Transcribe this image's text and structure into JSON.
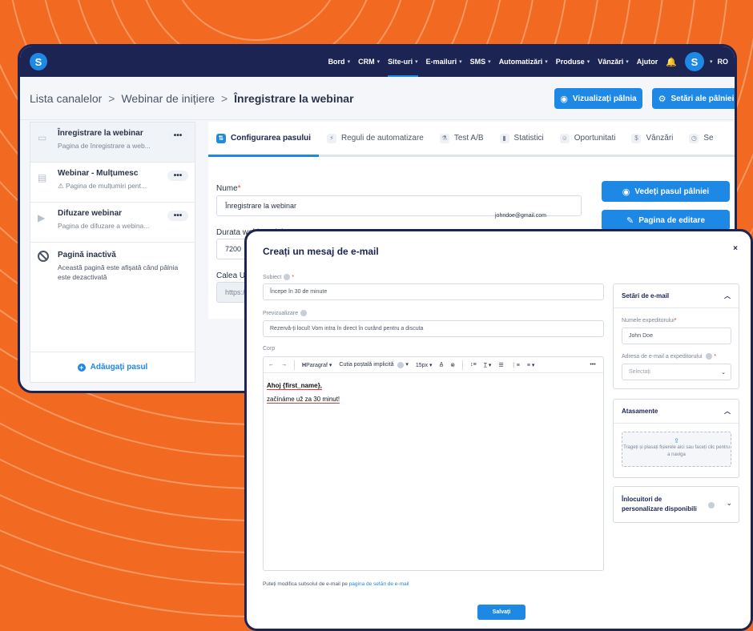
{
  "colors": {
    "background": "#f26a21",
    "nav": "#1b2453",
    "accent": "#1e88e5"
  },
  "nav": {
    "logo": "S",
    "items": [
      {
        "label": "Bord",
        "chevron": true,
        "active": false
      },
      {
        "label": "CRM",
        "chevron": true,
        "active": false
      },
      {
        "label": "Site-uri",
        "chevron": true,
        "active": true
      },
      {
        "label": "E-mailuri",
        "chevron": true,
        "active": false
      },
      {
        "label": "SMS",
        "chevron": true,
        "active": false
      },
      {
        "label": "Automatizări",
        "chevron": true,
        "active": false
      },
      {
        "label": "Produse",
        "chevron": true,
        "active": false
      },
      {
        "label": "Vânzări",
        "chevron": true,
        "active": false
      },
      {
        "label": "Ajutor",
        "chevron": false,
        "active": false
      }
    ],
    "bell_icon": "bell-icon",
    "avatar": "S",
    "lang": "RO"
  },
  "breadcrumb": {
    "items": [
      "Lista canalelor",
      "Webinar de inițiere",
      "Înregistrare la webinar"
    ],
    "separator": ">"
  },
  "header_buttons": {
    "view_funnel": "Vizualizați pâlnia",
    "funnel_settings": "Setări ale pâlniei"
  },
  "sidebar": {
    "steps": [
      {
        "title": "Înregistrare la webinar",
        "subtitle": "Pagina de înregistrare a web...",
        "active": true
      },
      {
        "title": "Webinar - Mulțumesc",
        "subtitle": "Pagina de mulțumiri pent...",
        "active": false
      },
      {
        "title": "Difuzare webinar",
        "subtitle": "Pagina de difuzare a webina...",
        "active": false
      }
    ],
    "inactive": {
      "title": "Pagină inactivă",
      "description": "Această pagină este afișată când pâlnia este dezactivată"
    },
    "dots": "•••",
    "add_step": "Adăugați pasul"
  },
  "tabs": [
    {
      "label": "Configurarea pasului",
      "active": true
    },
    {
      "label": "Reguli de automatizare",
      "active": false
    },
    {
      "label": "Test A/B",
      "active": false
    },
    {
      "label": "Statistici",
      "active": false
    },
    {
      "label": "Oportunitati",
      "active": false
    },
    {
      "label": "Vânzări",
      "active": false
    },
    {
      "label": "Se",
      "active": false
    }
  ],
  "form": {
    "name_label": "Nume",
    "name_value": "Înregistrare la webinar",
    "duration_label": "Durata webinarului",
    "duration_value": "7200",
    "url_label": "Calea UF",
    "url_value": "https:/",
    "email_tag": "johndoe@gmail.com",
    "view_step_button": "Vedeți pasul pâlniei",
    "edit_page_button": "Pagina de editare"
  },
  "modal": {
    "title": "Creați un mesaj de e-mail",
    "close": "×",
    "subject_label": "Subiect",
    "subject_value": "Începe în 30 de minute",
    "preview_label": "Previzualizare",
    "preview_value": "Rezervă-ți locul! Vom intra în direct în curând pentru a discuta",
    "body_label": "Corp",
    "toolbar": {
      "paragraph": "Paragraf",
      "font": "Cutia poștală implicită",
      "size": "15px"
    },
    "body_line1": "Ahoj {first_name},",
    "body_line2": "začínáme už za 30 minut!",
    "footer_text": "Puteți modifica subsolul de e-mail pe",
    "footer_link": "pagina de setări de e-mail",
    "save": "Salvați",
    "email_settings": {
      "title": "Setări de e-mail",
      "sender_label": "Numele expeditorului",
      "sender_value": "John Doe",
      "address_label": "Adresa de e-mail a expeditorului",
      "address_placeholder": "Selectați"
    },
    "attachments": {
      "title": "Atasamente",
      "drop_text": "Trageți și plasați fișierele aici sau faceți clic pentru a naviga"
    },
    "placeholders": {
      "title": "Înlocuitori de personalizare disponibili"
    }
  }
}
